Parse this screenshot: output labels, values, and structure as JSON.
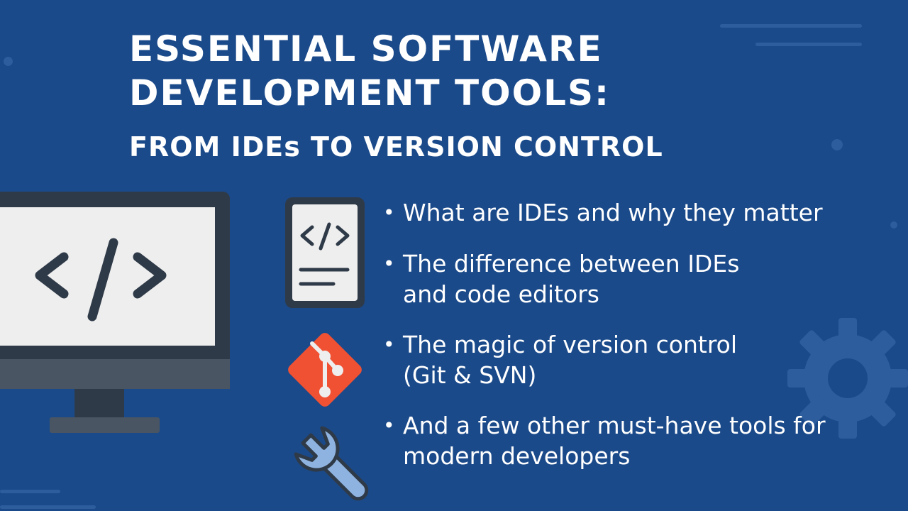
{
  "slide": {
    "title": "ESSENTIAL SOFTWARE DEVELOPMENT TOOLS:",
    "subtitle": "FROM IDEs TO VERSION CONTROL",
    "bullet_char": "•",
    "bullets": [
      {
        "text": "What are IDEs and why they matter",
        "icon": "code-file-icon"
      },
      {
        "text": "The difference between IDEs and code editors",
        "icon": ""
      },
      {
        "text": "The magic of version control (Git & SVN)",
        "icon": "git-icon"
      },
      {
        "text": "And a few other must-have tools for modern developers",
        "icon": "wrench-icon"
      }
    ],
    "monitor_symbol": "</>",
    "colors": {
      "background": "#1b4a8a",
      "monitor_frame": "#2f3a48",
      "monitor_screen": "#eeeeee",
      "git_orange": "#f05133",
      "wrench_blue": "#8fb3e0",
      "decor": "#2d5d9c"
    }
  }
}
